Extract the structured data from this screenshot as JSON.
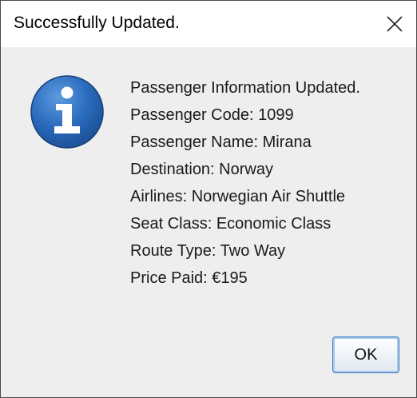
{
  "window": {
    "title": "Successfully Updated."
  },
  "icons": {
    "close": "close-icon",
    "info": "information-icon"
  },
  "message": {
    "lines": [
      "Passenger Information Updated.",
      "Passenger Code: 1099",
      "Passenger Name: Mirana",
      "Destination: Norway",
      "Airlines: Norwegian Air Shuttle",
      "Seat Class: Economic Class",
      "Route Type: Two Way",
      "Price Paid: €195"
    ]
  },
  "buttons": {
    "ok_label": "OK"
  },
  "colors": {
    "info_icon_blue": "#1f5fae",
    "button_border": "#3d7bc6",
    "dialog_background": "#eeeeee"
  }
}
